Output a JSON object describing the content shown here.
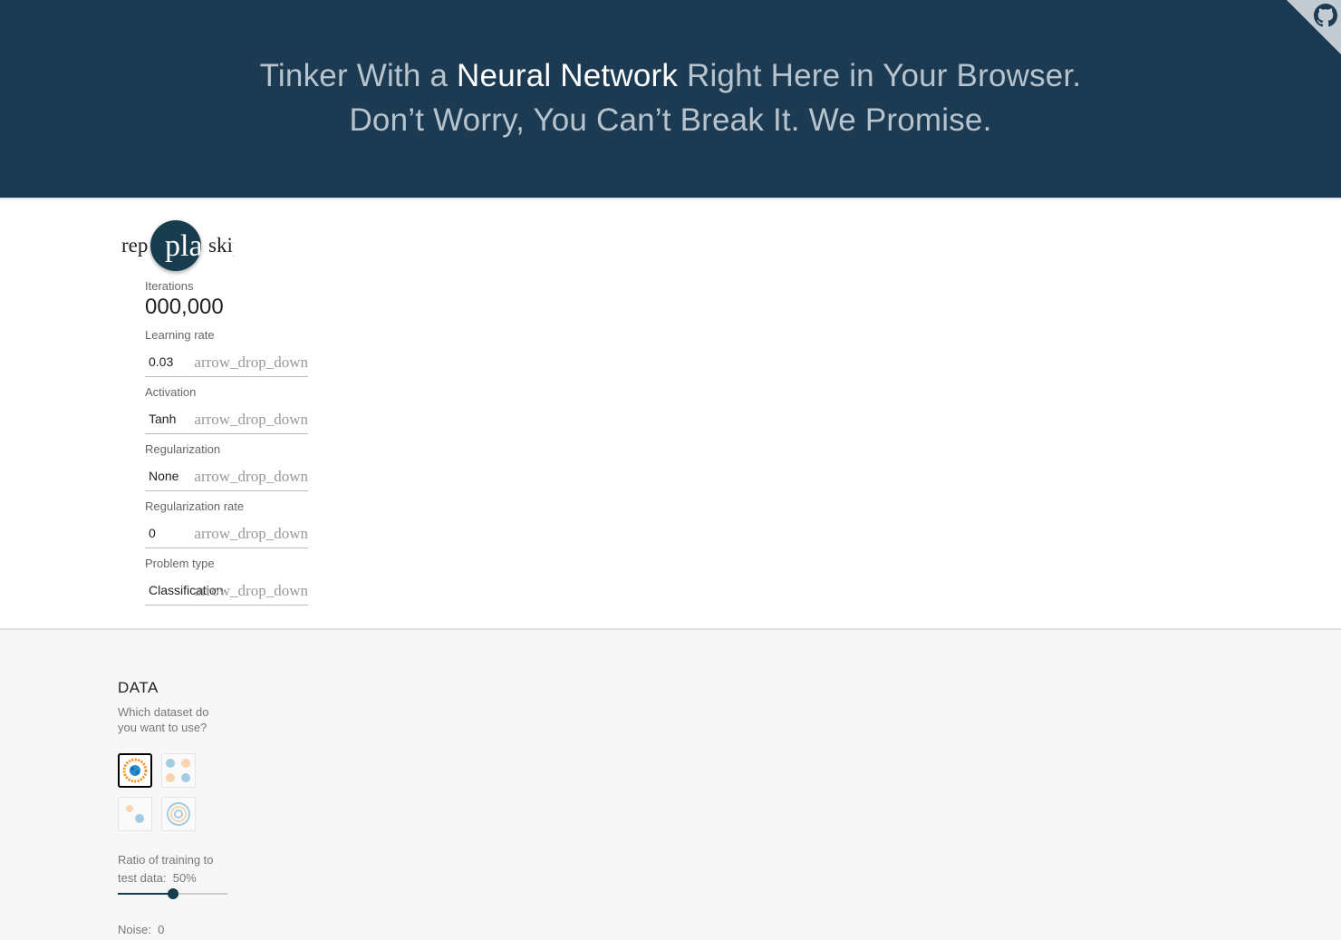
{
  "header": {
    "line1_pre": "Tinker With a ",
    "line1_em": "Neural Network",
    "line1_post": " Right Here in Your Browser.",
    "line2": "Don’t Worry, You Can’t Break It. We Promise."
  },
  "controls": {
    "reset_label": "replay",
    "play_label": "play_arrow",
    "skip_label": "skip_next",
    "iterations_label": "Iterations",
    "iterations_value": "000,000",
    "learning_rate": {
      "label": "Learning rate",
      "value": "0.03",
      "arrow": "arrow_drop_down"
    },
    "activation": {
      "label": "Activation",
      "value": "Tanh",
      "arrow": "arrow_drop_down"
    },
    "regularization": {
      "label": "Regularization",
      "value": "None",
      "arrow": "arrow_drop_down"
    },
    "regularization_rate": {
      "label": "Regularization rate",
      "value": "0",
      "arrow": "arrow_drop_down"
    },
    "problem_type": {
      "label": "Problem type",
      "value": "Classification",
      "arrow": "arrow_drop_down"
    }
  },
  "data": {
    "title": "DATA",
    "question": "Which dataset do you want to use?",
    "datasets": [
      {
        "name": "circle",
        "selected": true
      },
      {
        "name": "xor",
        "selected": false
      },
      {
        "name": "gaussian",
        "selected": false
      },
      {
        "name": "spiral",
        "selected": false
      }
    ],
    "ratio_label": "Ratio of training to test data:",
    "ratio_value": "50%",
    "ratio_fraction": 0.5,
    "noise_label": "Noise:",
    "noise_value": "0"
  },
  "colors": {
    "header_bg": "#1c3b52",
    "accent": "#183d4e",
    "orange": "#f59322",
    "blue": "#0877bd"
  },
  "icons": [
    "github-icon",
    "replay-icon",
    "play-icon",
    "skip-next-icon"
  ]
}
